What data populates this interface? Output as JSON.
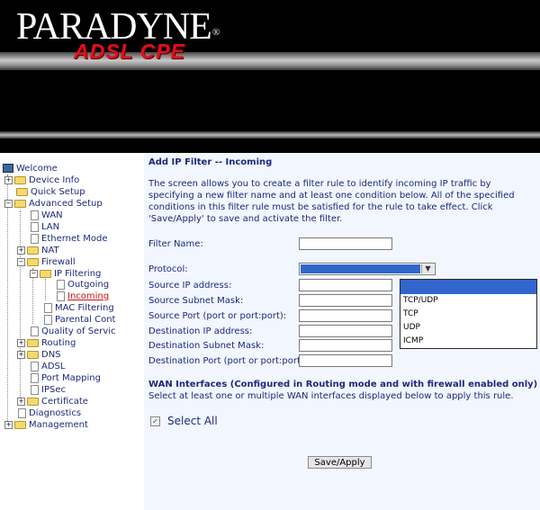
{
  "header": {
    "brand": "PARADYNE",
    "registered": "®",
    "product": "ADSL CPE"
  },
  "sidebar": {
    "welcome": "Welcome",
    "device_info": "Device Info",
    "quick_setup": "Quick Setup",
    "advanced_setup": "Advanced Setup",
    "wan": "WAN",
    "lan": "LAN",
    "ethernet_mode": "Ethernet Mode",
    "nat": "NAT",
    "firewall": "Firewall",
    "ip_filtering": "IP Filtering",
    "outgoing": "Outgoing",
    "incoming": "Incoming",
    "mac_filtering": "MAC Filtering",
    "parental_control": "Parental Cont",
    "quality_of_service": "Quality of Servic",
    "routing": "Routing",
    "dns": "DNS",
    "adsl": "ADSL",
    "port_mapping": "Port Mapping",
    "ipsec": "IPSec",
    "certificate": "Certificate",
    "diagnostics": "Diagnostics",
    "management": "Management"
  },
  "main": {
    "title": "Add IP Filter -- Incoming",
    "description": "The screen allows you to create a filter rule to identify incoming IP traffic by specifying a new filter name and at least one condition below. All of the specified conditions in this filter rule must be satisfied for the rule to take effect. Click 'Save/Apply' to save and activate the filter.",
    "fields": {
      "filter_name": "Filter Name:",
      "protocol": "Protocol:",
      "source_ip": "Source IP address:",
      "source_mask": "Source Subnet Mask:",
      "source_port": "Source Port (port or port:port):",
      "dest_ip": "Destination IP address:",
      "dest_mask": "Destination Subnet Mask:",
      "dest_port": "Destination Port (port or port:port):"
    },
    "protocol_options": [
      "",
      "TCP/UDP",
      "TCP",
      "UDP",
      "ICMP"
    ],
    "wan_title": "WAN Interfaces (Configured in Routing mode and with firewall enabled only)",
    "wan_desc": "Select at least one or multiple WAN interfaces displayed below to apply this rule.",
    "select_all": "Select All",
    "save_apply": "Save/Apply"
  }
}
